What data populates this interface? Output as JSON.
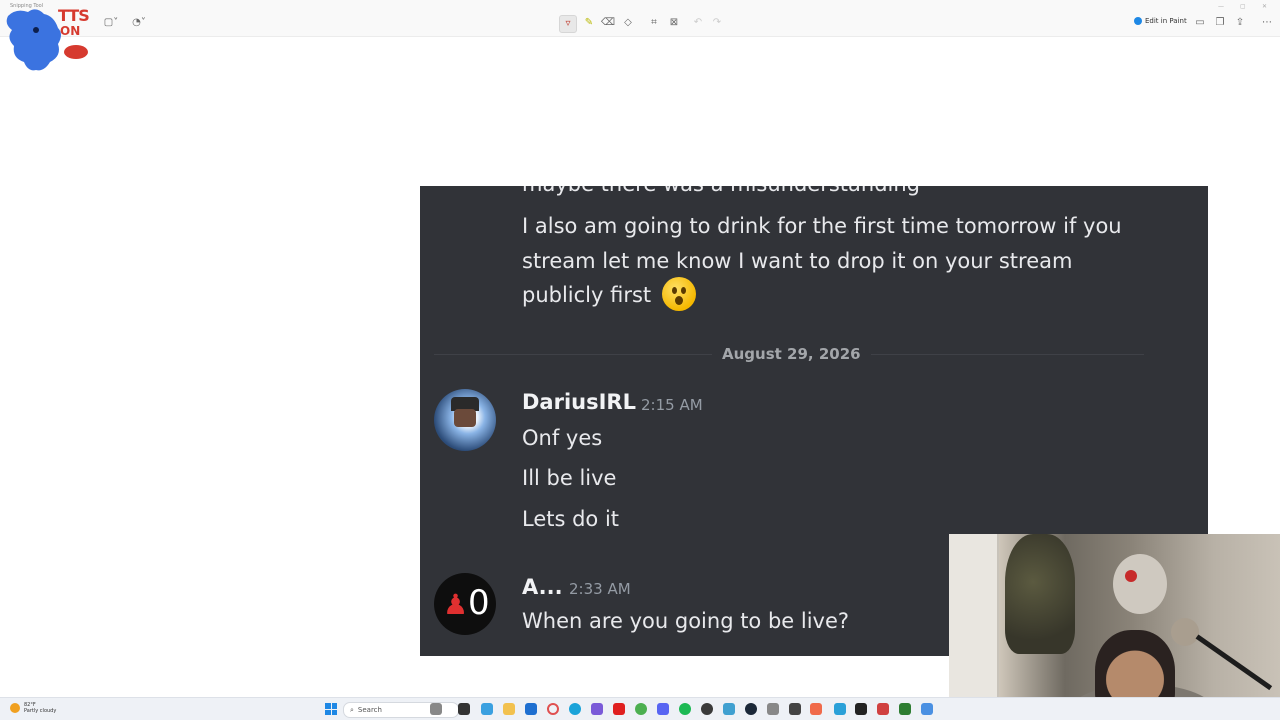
{
  "toolbar": {
    "app_title": "Snipping Tool",
    "edit_in_paint": "Edit in Paint",
    "icons": [
      "new-snip-icon",
      "snip-mode-icon",
      "delay-icon",
      "ballpoint-pen-icon",
      "highlighter-icon",
      "eraser-icon",
      "ruler-icon",
      "crop-icon",
      "text-actions-icon",
      "undo-icon",
      "redo-icon",
      "save-icon",
      "copy-icon",
      "share-icon",
      "more-icon"
    ]
  },
  "logo": {
    "line1": "TTS",
    "line2": "ON"
  },
  "chat": {
    "background": "#313338",
    "cut_line": "maybe there was a misunderstanding",
    "earlier_message_lines": [
      "I also am going to drink for the first time tomorrow if you",
      "stream let me know I want to drop it on your stream",
      "publicly first"
    ],
    "emoji": "hushed-face-emoji",
    "date_divider": "August 29, 2026",
    "messages": [
      {
        "username": "DariusIRL",
        "timestamp": "2:15 AM",
        "lines": [
          "Onf yes",
          "Ill be live",
          "Lets do it"
        ]
      },
      {
        "username": "A...",
        "timestamp": "2:33 AM",
        "avatar_text": "0",
        "lines": [
          "When are you going to be live?"
        ]
      }
    ]
  },
  "taskbar": {
    "weather_temp": "82°F",
    "weather_desc": "Partly cloudy",
    "search_placeholder": "Search",
    "accent": "#1e88e5"
  }
}
